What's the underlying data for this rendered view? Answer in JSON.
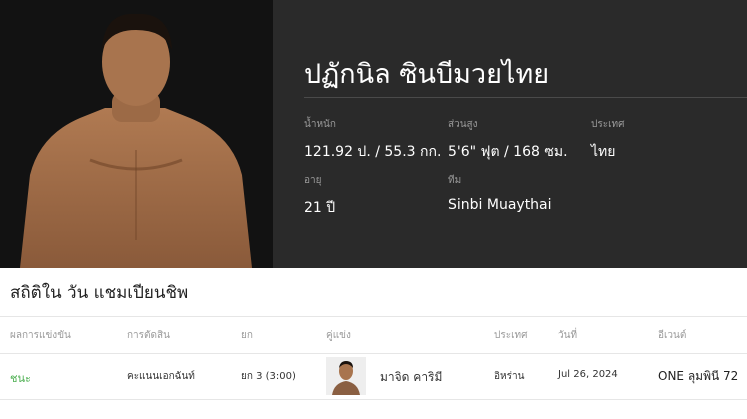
{
  "athlete": {
    "name": "ปฏักนิล ซินบีมวยไทย",
    "stats": [
      {
        "label": "น้ำหนัก",
        "value": "121.92 ป. / 55.3 กก."
      },
      {
        "label": "ส่วนสูง",
        "value": "5'6\" ฟุต / 168 ซม."
      },
      {
        "label": "ประเทศ",
        "value": "ไทย"
      },
      {
        "label": "อายุ",
        "value": "21 ปี"
      },
      {
        "label": "ทีม",
        "value": "Sinbi Muaythai"
      }
    ]
  },
  "record": {
    "title": "สถิติใน วัน แชมเปียนชิพ",
    "columns": [
      "ผลการแข่งขัน",
      "การตัดสิน",
      "ยก",
      "คู่แข่ง",
      "ประเทศ",
      "วันที่",
      "อีเวนต์"
    ],
    "rows": [
      {
        "result": "ชนะ",
        "method": "คะแนนเอกฉันท์",
        "round": "ยก 3 (3:00)",
        "opponent": "มาจิด คาริมี",
        "country": "อิหร่าน",
        "date": "Jul 26, 2024",
        "event": "ONE ลุมพินี 72"
      }
    ]
  },
  "colors": {
    "hero_bg": "#2a2a2a",
    "win": "#4caf50"
  }
}
